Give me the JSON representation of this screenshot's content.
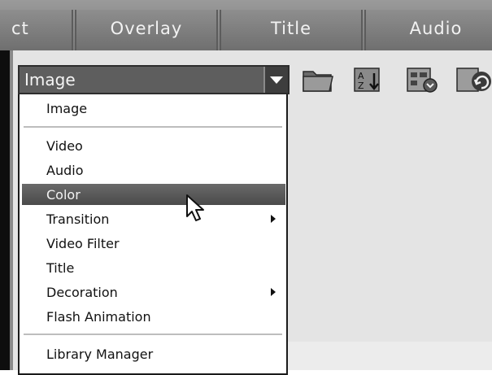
{
  "tabs": [
    {
      "id": "effect",
      "label": "ct"
    },
    {
      "id": "overlay",
      "label": "Overlay"
    },
    {
      "id": "title",
      "label": "Title"
    },
    {
      "id": "audio",
      "label": "Audio"
    }
  ],
  "combo": {
    "value": "Image"
  },
  "menu": {
    "items": [
      {
        "label": "Image",
        "selected": false,
        "submenu": false
      },
      {
        "label": "Video",
        "selected": false,
        "submenu": false
      },
      {
        "label": "Audio",
        "selected": false,
        "submenu": false
      },
      {
        "label": "Color",
        "selected": true,
        "submenu": false
      },
      {
        "label": "Transition",
        "selected": false,
        "submenu": true
      },
      {
        "label": "Video Filter",
        "selected": false,
        "submenu": false
      },
      {
        "label": "Title",
        "selected": false,
        "submenu": false
      },
      {
        "label": "Decoration",
        "selected": false,
        "submenu": true
      },
      {
        "label": "Flash Animation",
        "selected": false,
        "submenu": false
      },
      {
        "label": "Library Manager",
        "selected": false,
        "submenu": false
      }
    ]
  },
  "icons": {
    "open": "folder-open-icon",
    "sort": "sort-az-icon",
    "view": "view-options-icon",
    "refresh": "refresh-icon"
  },
  "colors": {
    "tab_bg": "#7c7c7c",
    "combo_bg": "#5e5e5e",
    "selection": "#4a4a4a",
    "panel_bg": "#e4e4e4"
  }
}
